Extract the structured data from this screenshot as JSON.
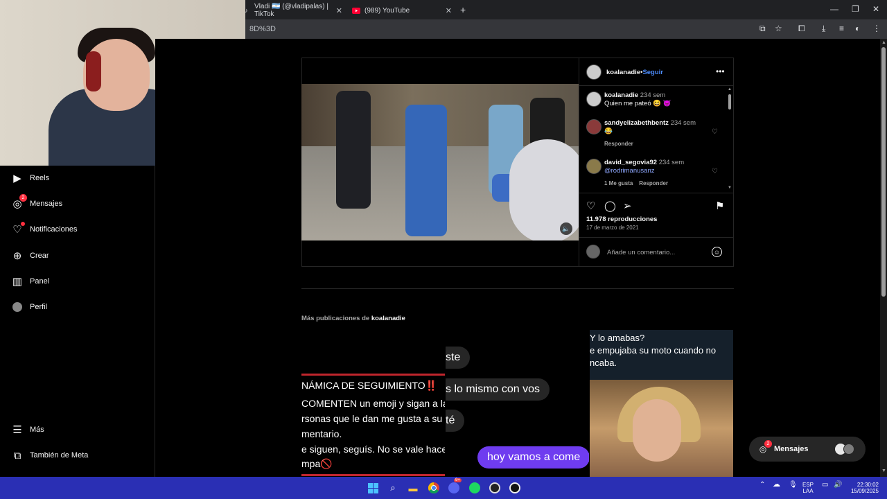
{
  "browser": {
    "tabs": [
      {
        "title": "Vladi 🇦🇷 (@vladipalas) | TikTok",
        "icon": "tiktok-icon"
      },
      {
        "title": "(989) YouTube",
        "icon": "youtube-icon"
      }
    ],
    "url_fragment": "8D%3D"
  },
  "sidebar": {
    "items": [
      {
        "label": "Reels",
        "icon": "reels-icon"
      },
      {
        "label": "Mensajes",
        "icon": "messenger-icon",
        "badge": "2"
      },
      {
        "label": "Notificaciones",
        "icon": "heart-icon",
        "dot": true
      },
      {
        "label": "Crear",
        "icon": "plus-square-icon"
      },
      {
        "label": "Panel",
        "icon": "chart-icon"
      },
      {
        "label": "Perfil",
        "icon": "avatar-icon"
      }
    ],
    "bottom": [
      {
        "label": "Más",
        "icon": "menu-icon"
      },
      {
        "label": "También de Meta",
        "icon": "meta-icon"
      }
    ]
  },
  "post": {
    "username": "koalanadie",
    "separator": " • ",
    "follow": "Seguir",
    "comments": [
      {
        "user": "koalanadie",
        "time": "234 sem",
        "text": "Quien me pateó 😆 😈"
      },
      {
        "user": "sandyelizabethbentz",
        "time": "234 sem",
        "text": "😂",
        "reply": "Responder"
      },
      {
        "user": "david_segovia92",
        "time": "234 sem",
        "text": "@rodrimanusanz",
        "likes": "1 Me gusta",
        "reply": "Responder"
      }
    ],
    "views": "11.978 reproducciones",
    "date": "17 de marzo de 2021",
    "comment_placeholder": "Añade un comentario..."
  },
  "more_posts": {
    "prefix": "Más publicaciones de ",
    "user": "koalanadie",
    "thumb1": {
      "lines": [
        "NÁMICA DE SEGUIMIENTO‼️",
        "COMENTEN un emoji y sigan a la",
        "rsonas que le dan me gusta a su",
        "mentario.",
        "e siguen, seguís. No se vale hace",
        "mpa🚫"
      ]
    },
    "thumb2": {
      "bubbles": [
        "ste",
        "s lo mismo con vos",
        "té",
        "hoy vamos a come"
      ]
    },
    "thumb3": {
      "lines": [
        "Y lo amabas?",
        "e empujaba su moto cuando no",
        "ncaba."
      ]
    }
  },
  "messages_pill": {
    "label": "Mensajes",
    "badge": "2"
  },
  "taskbar": {
    "lang_top": "ESP",
    "lang_bottom": "LAA",
    "time": "22:30:02",
    "date": "15/09/2025",
    "discord_badge": "9+"
  },
  "colors": {
    "accent": "#4d8dff",
    "badge": "#ff3040",
    "taskbar": "#2a2fb4"
  }
}
